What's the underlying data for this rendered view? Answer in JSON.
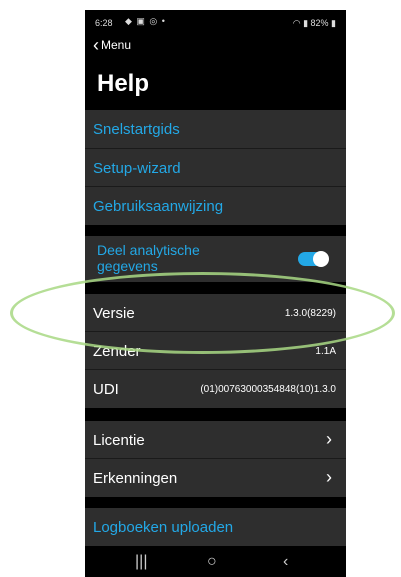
{
  "status_bar": {
    "time": "6:28",
    "notification_icons": "◆ ▣ ◎ •",
    "battery": "82%"
  },
  "nav": {
    "back_label": "Menu"
  },
  "page": {
    "title": "Help"
  },
  "links": [
    {
      "label": "Snelstartgids"
    },
    {
      "label": "Setup-wizard"
    },
    {
      "label": "Gebruiksaanwijzing"
    }
  ],
  "analytics": {
    "label": "Deel analytische gegevens",
    "enabled": true
  },
  "info": [
    {
      "label": "Versie",
      "value": "1.3.0(8229)"
    },
    {
      "label": "Zender",
      "value": "1.1A"
    },
    {
      "label": "UDI",
      "value": "(01)00763000354848(10)1.3.0"
    }
  ],
  "legal": [
    {
      "label": "Licentie"
    },
    {
      "label": "Erkenningen"
    }
  ],
  "upload": {
    "label": "Logboeken uploaden"
  },
  "colors": {
    "accent": "#23a8e6",
    "row_bg": "#2e2e2e",
    "highlight": "#a8d884"
  }
}
